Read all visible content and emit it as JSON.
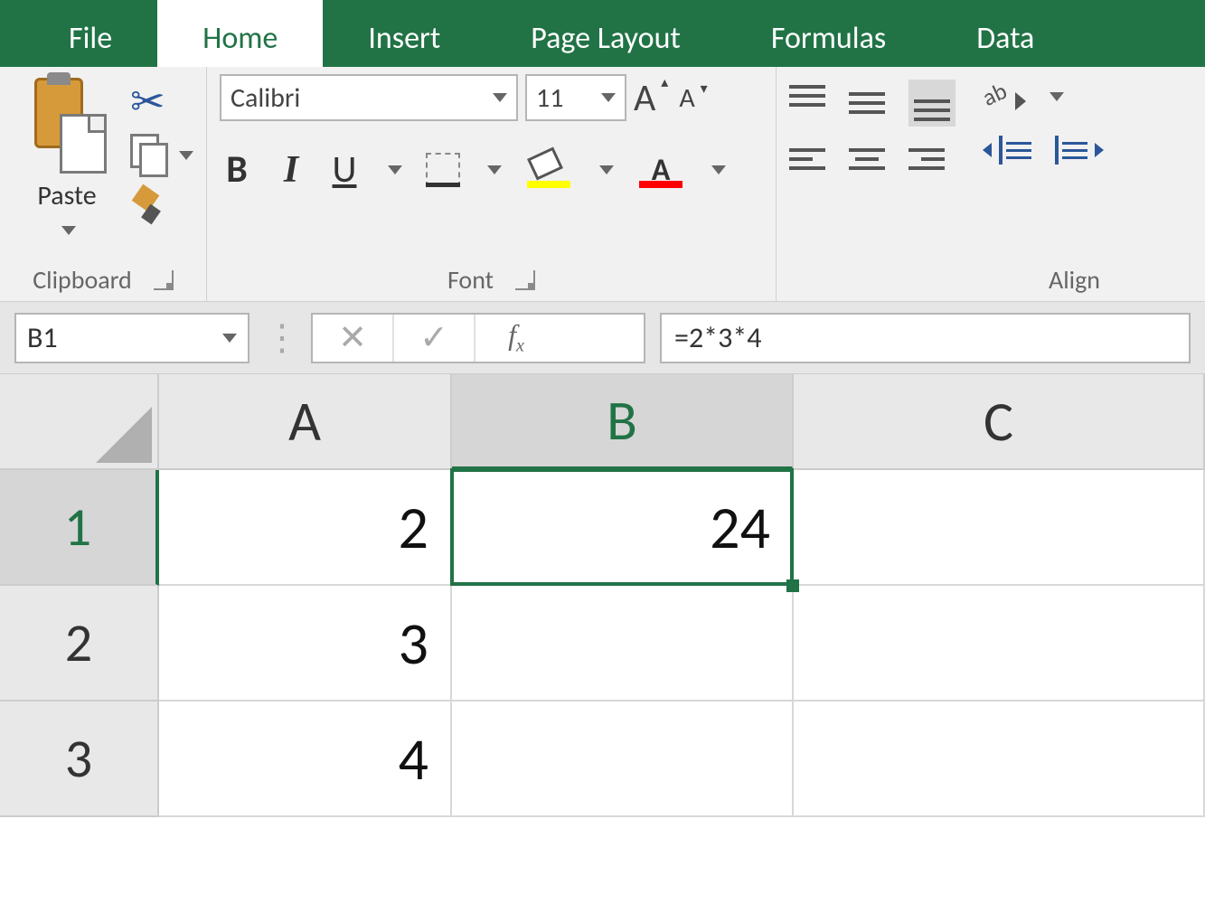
{
  "tabs": {
    "file": "File",
    "home": "Home",
    "insert": "Insert",
    "pageLayout": "Page Layout",
    "formulas": "Formulas",
    "data": "Data"
  },
  "ribbon": {
    "clipboard": {
      "label": "Clipboard",
      "paste": "Paste"
    },
    "font": {
      "label": "Font",
      "name": "Calibri",
      "size": "11",
      "bold": "B",
      "italic": "I",
      "underline": "U",
      "increaseA": "A",
      "decreaseA": "A",
      "fontColorA": "A"
    },
    "alignment": {
      "label": "Align",
      "wrapAb": "ab"
    }
  },
  "formulaBar": {
    "nameBox": "B1",
    "fxF": "f",
    "fxX": "x",
    "cancel": "✕",
    "enter": "✓",
    "formula": "=2*3*4"
  },
  "grid": {
    "cols": {
      "A": "A",
      "B": "B",
      "C": "C"
    },
    "rows": {
      "r1": "1",
      "r2": "2",
      "r3": "3"
    },
    "cells": {
      "A1": "2",
      "A2": "3",
      "A3": "4",
      "B1": "24",
      "B2": "",
      "B3": "",
      "C1": "",
      "C2": "",
      "C3": ""
    },
    "selected": "B1"
  }
}
